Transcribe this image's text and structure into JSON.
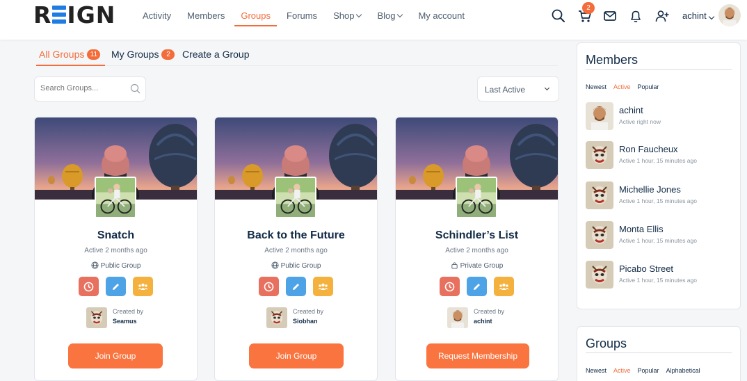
{
  "header": {
    "logo": "REIGN",
    "nav": [
      {
        "label": "Activity",
        "active": false,
        "caret": false
      },
      {
        "label": "Members",
        "active": false,
        "caret": false
      },
      {
        "label": "Groups",
        "active": true,
        "caret": false
      },
      {
        "label": "Forums",
        "active": false,
        "caret": false
      },
      {
        "label": "Shop",
        "active": false,
        "caret": true
      },
      {
        "label": "Blog",
        "active": false,
        "caret": true
      },
      {
        "label": "My account",
        "active": false,
        "caret": false
      }
    ],
    "cart_count": "2",
    "user_name": "achint"
  },
  "tabs": [
    {
      "label": "All Groups",
      "count": "11",
      "active": true
    },
    {
      "label": "My Groups",
      "count": "2",
      "active": false
    },
    {
      "label": "Create a Group",
      "count": "",
      "active": false
    }
  ],
  "search": {
    "placeholder": "Search Groups..."
  },
  "sort": {
    "selected": "Last Active"
  },
  "groups": [
    {
      "title": "Snatch",
      "active": "Active 2 months ago",
      "type": "Public Group",
      "created_by_label": "Created by",
      "creator": "Seamus",
      "button": "Join Group"
    },
    {
      "title": "Back to the Future",
      "active": "Active 2 months ago",
      "type": "Public Group",
      "created_by_label": "Created by",
      "creator": "Siobhan",
      "button": "Join Group"
    },
    {
      "title": "Schindler’s List",
      "active": "Active 2 months ago",
      "type": "Private Group",
      "created_by_label": "Created by",
      "creator": "achint",
      "button": "Request Membership"
    }
  ],
  "members_widget": {
    "title": "Members",
    "filters": [
      "Newest",
      "Active",
      "Popular"
    ],
    "active_filter": "Active",
    "members": [
      {
        "name": "achint",
        "status": "Active right now"
      },
      {
        "name": "Ron Faucheux",
        "status": "Active 1 hour, 15 minutes ago"
      },
      {
        "name": "Michellie Jones",
        "status": "Active 1 hour, 15 minutes ago"
      },
      {
        "name": "Monta Ellis",
        "status": "Active 1 hour, 15 minutes ago"
      },
      {
        "name": "Picabo Street",
        "status": "Active 1 hour, 15 minutes ago"
      }
    ]
  },
  "groups_widget": {
    "title": "Groups",
    "filters": [
      "Newest",
      "Active",
      "Popular",
      "Alphabetical"
    ],
    "active_filter": "Active"
  },
  "colors": {
    "accent": "#f36c3a",
    "button": "#f9743f",
    "red_icon": "#e8705f",
    "blue_icon": "#4ea3e6",
    "yellow_icon": "#f4b13e"
  },
  "icons": [
    "search-icon",
    "cart-icon",
    "mail-icon",
    "bell-icon",
    "user-plus-icon",
    "clock-icon",
    "pencil-icon",
    "users-icon",
    "globe-icon",
    "lock-icon"
  ]
}
